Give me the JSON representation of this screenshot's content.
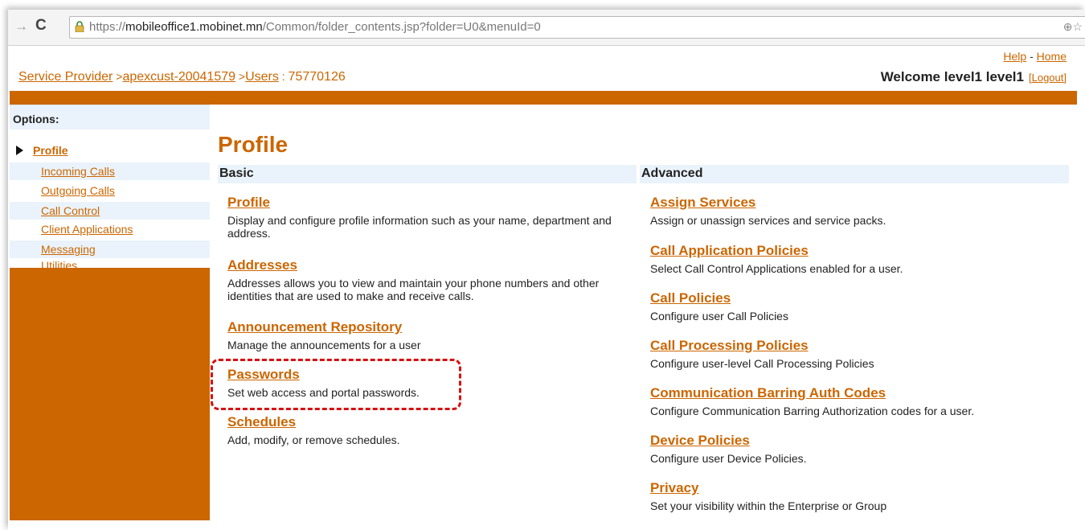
{
  "browser": {
    "url_scheme": "https://",
    "url_host": "mobileoffice1.mobinet.mn",
    "url_path": "/Common/folder_contents.jsp?folder=U0&menuId=0",
    "forward_glyph": "→",
    "reload_glyph": "C",
    "zoom_glyph": "⊕☆"
  },
  "header": {
    "help": "Help",
    "help_sep": " - ",
    "home": "Home",
    "breadcrumb": {
      "service_provider": "Service Provider",
      "sep1": " >",
      "group": "apexcust-20041579",
      "sep2": " >",
      "users": "Users",
      "sep3": " : ",
      "user_id": "75770126"
    },
    "welcome": "Welcome level1 level1",
    "logout": "[Logout]"
  },
  "sidebar": {
    "title": "Options:",
    "items": [
      {
        "label": "Profile",
        "selected": true
      },
      {
        "label": "Incoming Calls"
      },
      {
        "label": "Outgoing Calls"
      },
      {
        "label": "Call Control"
      },
      {
        "label": "Client Applications"
      },
      {
        "label": "Messaging"
      },
      {
        "label": "Utilities"
      }
    ]
  },
  "main": {
    "title": "Profile",
    "basic": {
      "heading": "Basic",
      "items": [
        {
          "title": "Profile",
          "desc": "Display and configure profile information such as your name, department and address."
        },
        {
          "title": "Addresses",
          "desc": "Addresses allows you to view and maintain your phone numbers and other identities that are used to make and receive calls."
        },
        {
          "title": "Announcement Repository",
          "desc": "Manage the announcements for a user"
        },
        {
          "title": "Passwords",
          "desc": "Set web access and portal passwords."
        },
        {
          "title": "Schedules",
          "desc": "Add, modify, or remove schedules."
        }
      ]
    },
    "advanced": {
      "heading": "Advanced",
      "items": [
        {
          "title": "Assign Services",
          "desc": "Assign or unassign services and service packs."
        },
        {
          "title": "Call Application Policies",
          "desc": "Select Call Control Applications enabled for a user."
        },
        {
          "title": "Call Policies",
          "desc": "Configure user Call Policies"
        },
        {
          "title": "Call Processing Policies",
          "desc": "Configure user-level Call Processing Policies"
        },
        {
          "title": "Communication Barring Auth Codes",
          "desc": "Configure Communication Barring Authorization codes for a user."
        },
        {
          "title": "Device Policies",
          "desc": "Configure user Device Policies."
        },
        {
          "title": "Privacy",
          "desc": "Set your visibility within the Enterprise or Group"
        }
      ]
    }
  },
  "colors": {
    "accent": "#cc6600",
    "highlight_box": "#d61111",
    "section_header_bg": "#eaf3fb"
  }
}
